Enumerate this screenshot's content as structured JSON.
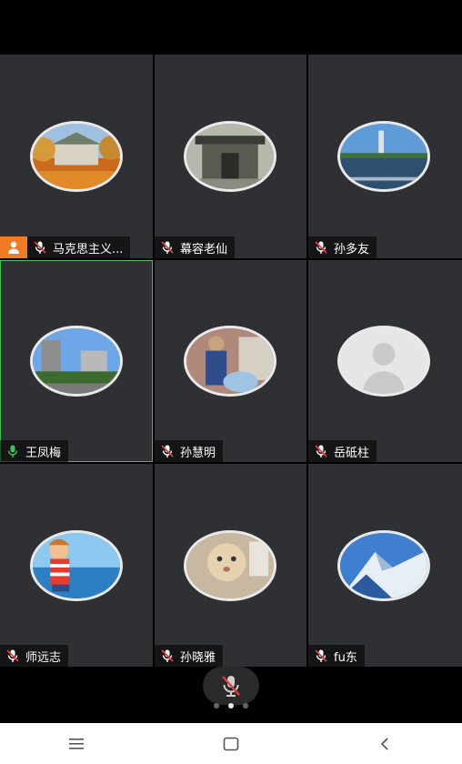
{
  "participants": [
    {
      "name": "马克思主义...",
      "host": true
    },
    {
      "name": "幕容老仙"
    },
    {
      "name": "孙多友"
    },
    {
      "name": "王凤梅",
      "active_speaker": true
    },
    {
      "name": "孙慧明"
    },
    {
      "name": "岳砥柱"
    },
    {
      "name": "师远志"
    },
    {
      "name": "孙晓雅"
    },
    {
      "name": "fu东"
    }
  ],
  "pager": {
    "current_page": 2,
    "total_pages": 3
  },
  "colors": {
    "host_badge": "#f07b23",
    "active_outline": "#3fc25a",
    "muted_mic": "#e23b3b"
  },
  "icons": {
    "host": "person-icon",
    "mic_muted": "mic-muted-icon",
    "nav": [
      "menu-icon",
      "home-square-icon",
      "back-icon"
    ]
  }
}
